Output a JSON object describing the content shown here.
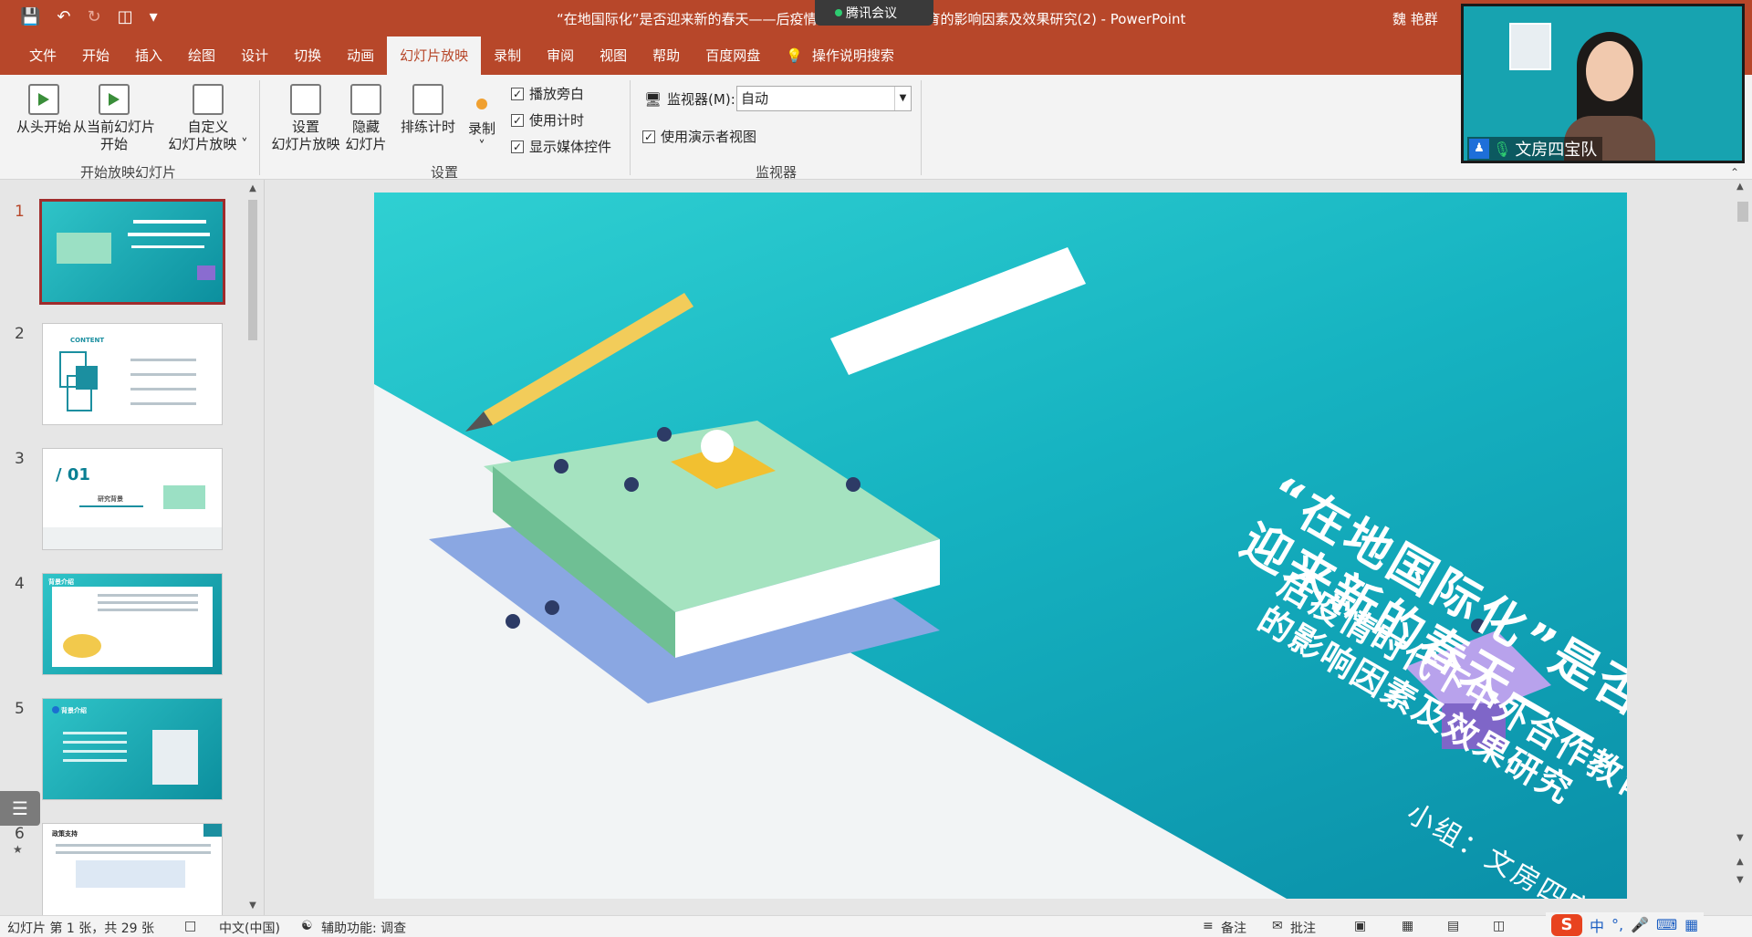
{
  "window": {
    "title": "“在地国际化”是否迎来新的春天——后疫情时代下中外合作教育的影响因素及效果研究(2)  -  PowerPoint",
    "user": "魏 艳群",
    "meeting_pill": "腾讯会议"
  },
  "ribbon_tabs": [
    "文件",
    "开始",
    "插入",
    "绘图",
    "设计",
    "切换",
    "动画",
    "幻灯片放映",
    "录制",
    "审阅",
    "视图",
    "帮助",
    "百度网盘"
  ],
  "active_tab": "幻灯片放映",
  "search_label": "操作说明搜索",
  "ribbon": {
    "from_start": "从头开始",
    "from_current_1": "从当前幻灯片",
    "from_current_2": "开始",
    "custom_1": "自定义",
    "custom_2": "幻灯片放映 ˅",
    "group_start": "开始放映幻灯片",
    "setup_1": "设置",
    "setup_2": "幻灯片放映",
    "hide_1": "隐藏",
    "hide_2": "幻灯片",
    "rehearse": "排练计时",
    "record_1": "录制",
    "record_2": "˅",
    "play_narration": "播放旁白",
    "use_timings": "使用计时",
    "show_media_controls": "显示媒体控件",
    "group_setup": "设置",
    "monitor_label": "监视器(M):",
    "monitor_value": "自动",
    "presenter_view": "使用演示者视图",
    "group_monitor": "监视器"
  },
  "webcam": {
    "caption": "文房四宝队"
  },
  "thumbnails": [
    {
      "num": "1"
    },
    {
      "num": "2",
      "label": "CONTENT"
    },
    {
      "num": "3",
      "label": "/ 01",
      "sub": "研究背景"
    },
    {
      "num": "4",
      "label": "背景介绍"
    },
    {
      "num": "5",
      "label": "背景介绍"
    },
    {
      "num": "6",
      "label": "政策支持"
    }
  ],
  "slide": {
    "title_line1": "“在地国际化”是否",
    "title_line2": "迎来新的春天——",
    "subtitle_line1": "后疫情时代下中外合作教育",
    "subtitle_line2": "的影响因素及效果研究",
    "team": "小组：文房四宝队"
  },
  "status": {
    "slide_info": "幻灯片 第 1 张，共 29 张",
    "language": "中文(中国)",
    "accessibility": "辅助功能: 调查",
    "notes": "备注",
    "comments": "批注"
  },
  "ime": {
    "mode": "中"
  }
}
